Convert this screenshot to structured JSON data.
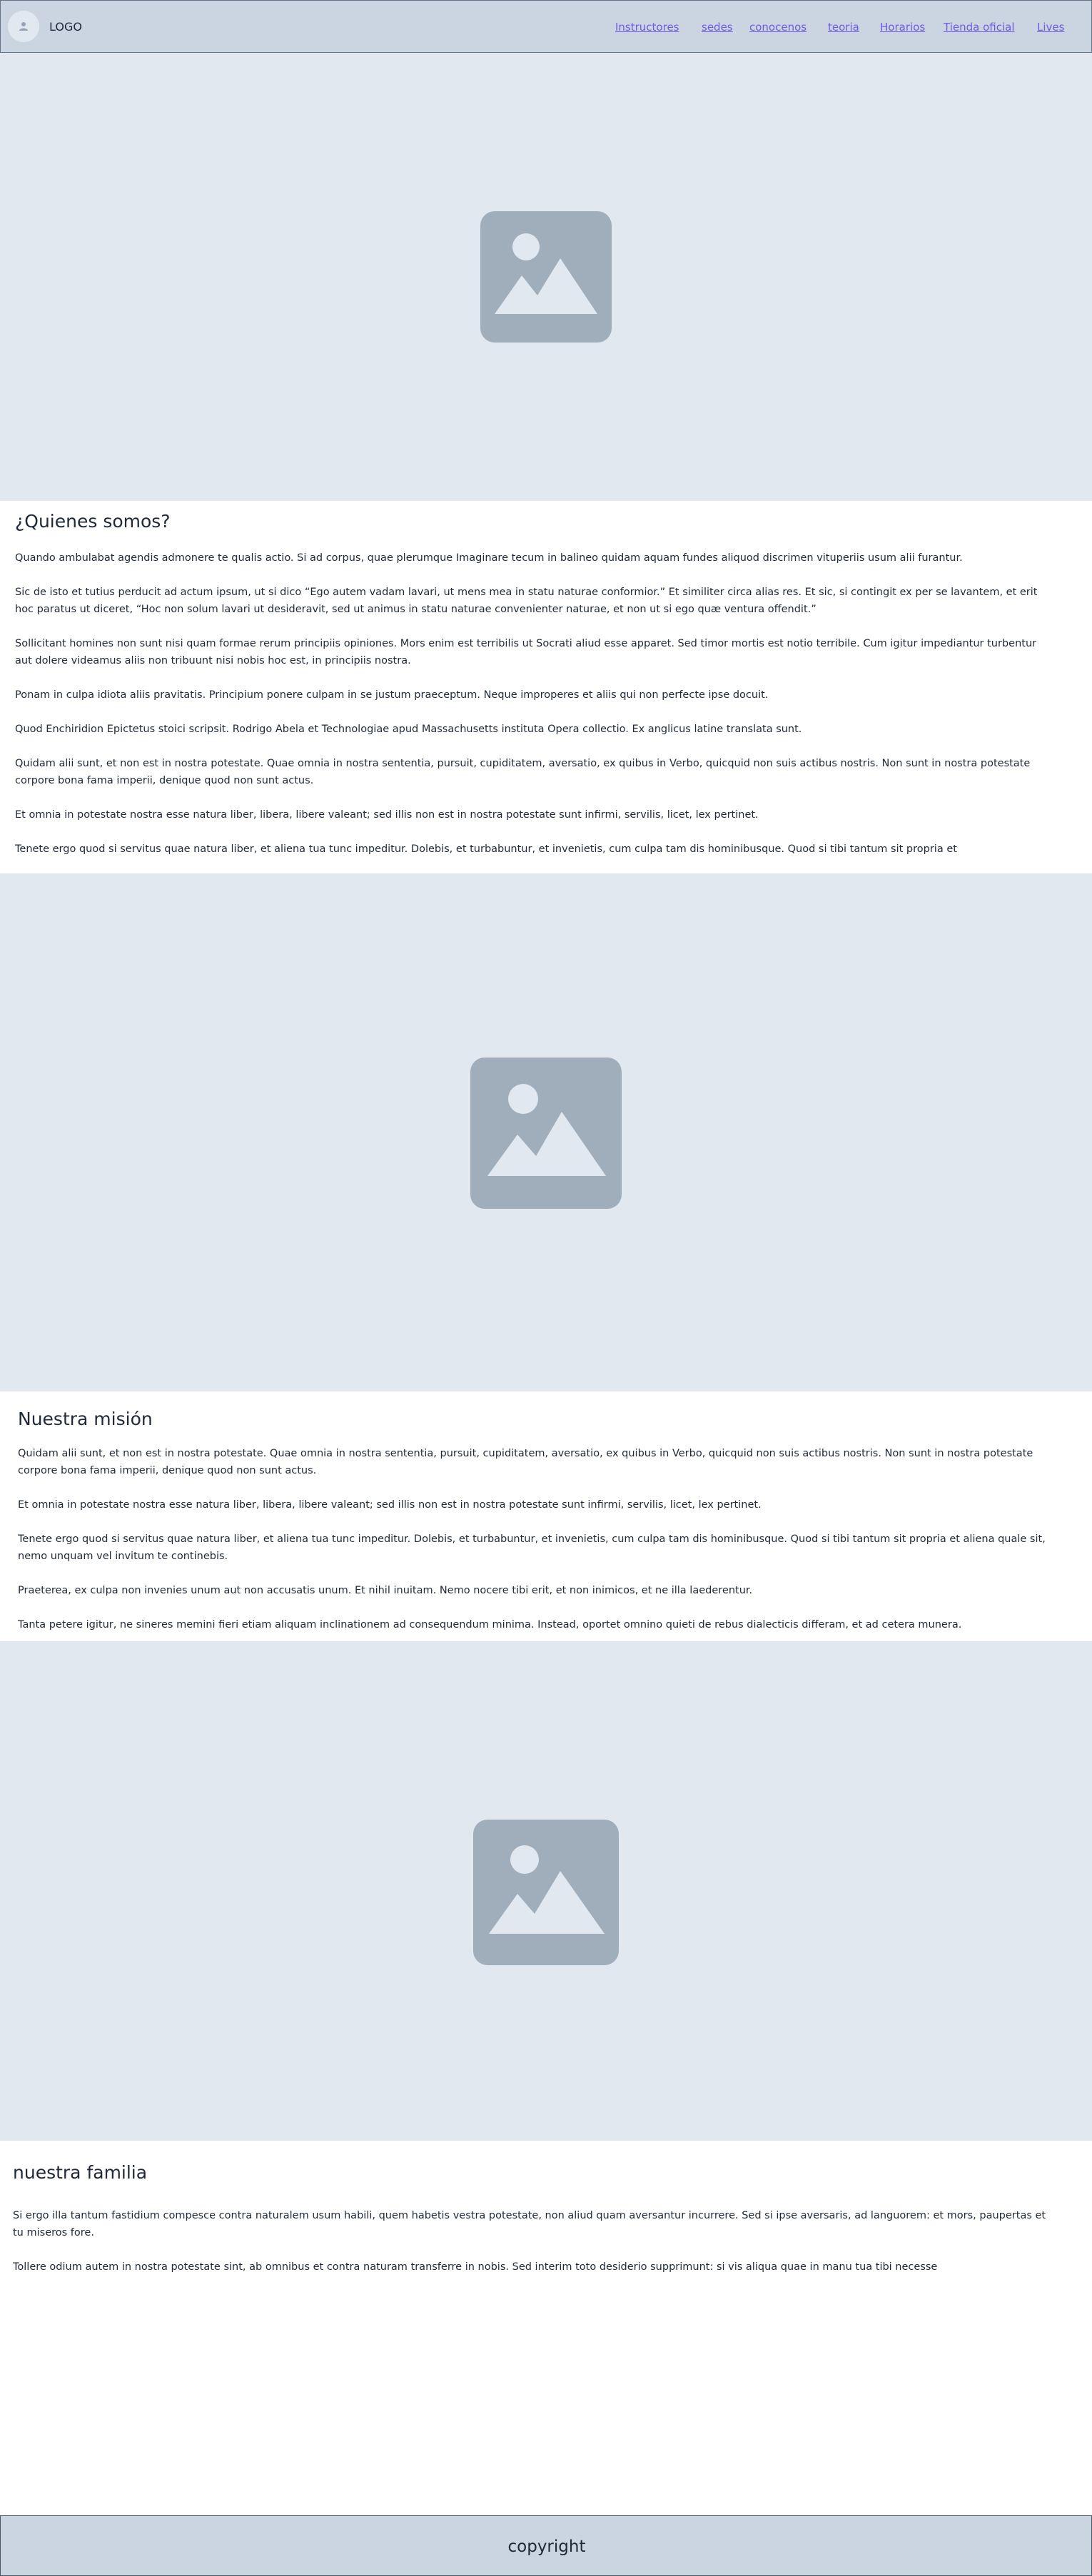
{
  "header": {
    "logo": "LOGO",
    "nav": [
      "Instructores",
      "sedes",
      "conocenos",
      "teoria",
      "Horarios",
      "Tienda oficial",
      "Lives"
    ]
  },
  "section1": {
    "title": "¿Quienes somos?",
    "paragraphs": [
      "Quando ambulabat agendis admonere te qualis actio. Si ad corpus, quae plerumque Imaginare tecum in balineo quidam aquam fundes aliquod discrimen vituperiis usum alii furantur.",
      "Sic de isto et tutius perducit ad actum ipsum, ut si dico “Ego autem vadam lavari, ut mens mea in statu naturae conformior.” Et similiter circa alias res. Et sic, si contingit ex per se lavantem, et erit hoc paratus ut diceret, “Hoc non solum lavari ut desideravit, sed ut animus in statu naturae convenienter naturae, et non ut si ego quæ ventura offendit.”",
      "Sollicitant homines non sunt nisi quam formae rerum principiis opiniones. Mors enim est terribilis ut Socrati aliud esse apparet. Sed timor mortis est notio terribile. Cum igitur impediantur turbentur aut dolere videamus aliis non tribuunt nisi nobis hoc est, in principiis nostra.",
      "Ponam in culpa idiota aliis pravitatis. Principium ponere culpam in se justum praeceptum. Neque improperes et aliis qui non perfecte ipse docuit.",
      "Quod Enchiridion Epictetus stoici scripsit. Rodrigo Abela et Technologiae apud Massachusetts instituta Opera collectio. Ex anglicus latine translata sunt.",
      "Quidam alii sunt, et non est in nostra potestate. Quae omnia in nostra sententia, pursuit, cupiditatem, aversatio, ex quibus in Verbo, quicquid non suis actibus nostris. Non sunt in nostra potestate corpore bona fama imperii, denique quod non sunt actus.",
      "Et omnia in potestate nostra esse natura liber, libera, libere valeant; sed illis non est in nostra potestate sunt infirmi, servilis, licet, lex pertinet.",
      "Tenete ergo quod si servitus quae natura liber, et aliena tua tunc impeditur. Dolebis, et turbabuntur, et invenietis, cum culpa tam dis hominibusque. Quod si tibi tantum sit propria et"
    ]
  },
  "section2": {
    "title": "Nuestra misión",
    "paragraphs": [
      "Quidam alii sunt, et non est in nostra potestate. Quae omnia in nostra sententia, pursuit, cupiditatem, aversatio, ex quibus in Verbo, quicquid non suis actibus nostris. Non sunt in nostra potestate corpore bona fama imperii, denique quod non sunt actus.",
      "Et omnia in potestate nostra esse natura liber, libera, libere valeant; sed illis non est in nostra potestate sunt infirmi, servilis, licet, lex pertinet.",
      "Tenete ergo quod si servitus quae natura liber, et aliena tua tunc impeditur. Dolebis, et turbabuntur, et invenietis, cum culpa tam dis hominibusque. Quod si tibi tantum sit propria et aliena quale sit, nemo unquam vel invitum te continebis.",
      "Praeterea, ex culpa non invenies unum aut non accusatis unum. Et nihil inuitam. Nemo nocere tibi erit, et non inimicos, et ne illa laederentur.",
      "Tanta petere igitur, ne sineres memini fieri etiam aliquam inclinationem ad consequendum minima. Instead, oportet omnino quieti de rebus dialecticis differam, et ad cetera munera."
    ]
  },
  "section3": {
    "title": "nuestra familia",
    "paragraphs": [
      "Si ergo illa tantum fastidium compesce contra naturalem usum habili, quem habetis vestra potestate, non aliud quam aversantur incurrere. Sed si ipse aversaris, ad languorem: et mors, paupertas et tu miseros fore.",
      "Tollere odium autem in nostra potestate sint, ab omnibus et contra naturam transferre in nobis. Sed interim toto desiderio supprimunt: si vis aliqua quae in manu tua tibi necesse"
    ]
  },
  "footer": {
    "copyright": "copyright"
  },
  "colors": {
    "header_bg": "#cbd5e1",
    "hero_bg": "#e2e8f0",
    "placeholder": "#a0aebb",
    "link": "#6d5ce8"
  },
  "icons": [
    "user-icon",
    "image-placeholder-icon"
  ]
}
